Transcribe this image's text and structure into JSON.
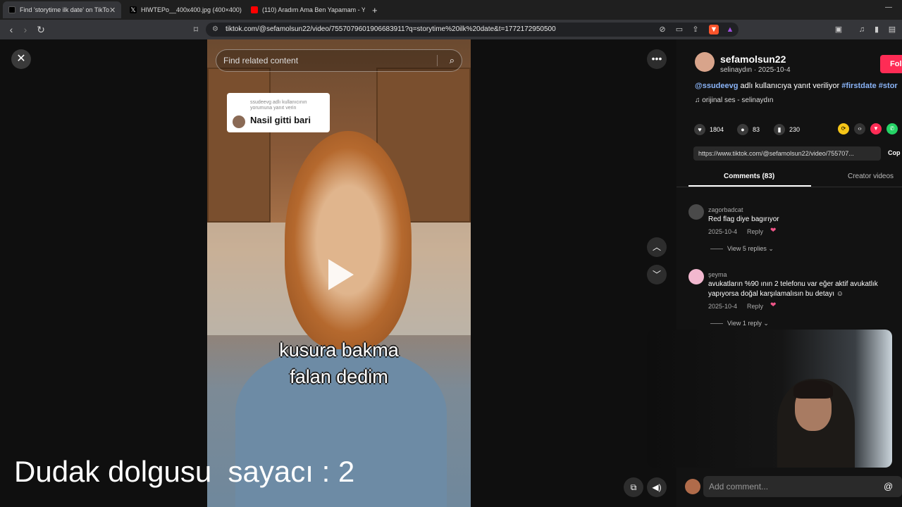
{
  "tabs": [
    {
      "title": "Find 'storytime ilk date' on TikTo",
      "close": "✕"
    },
    {
      "title": "HIWTEPo__400x400.jpg (400×400)"
    },
    {
      "title": "(110) Aradım Ama Ben Yapamam - Yo"
    }
  ],
  "new_tab": "+",
  "minimize": "—",
  "url": "tiktok.com/@sefamolsun22/video/7557079601906683911?q=storytime%20ilk%20date&t=1772172950500",
  "search": {
    "placeholder": "Find related content"
  },
  "reply_card": {
    "small": "ssudeevg adlı kullanıcının yorumuna yanıt verin",
    "big": "Nasil gitti bari"
  },
  "caption": {
    "line1": "kusura bakma",
    "line2": "falan dedim"
  },
  "overlay_counter": "Dudak dolgusu  sayacı : 2",
  "author": {
    "name": "sefamolsun22",
    "meta": "selinaydın · 2025-10-4",
    "follow": "Fol"
  },
  "description": {
    "mention": "@ssudeevg",
    "text": " adlı kullanıcıya yanıt veriliyor ",
    "tags": "#firstdate #stor"
  },
  "music": "♫  orijinal ses - selinaydın",
  "stats": {
    "likes": "1804",
    "comments": "83",
    "saves": "230"
  },
  "share_link": "https://www.tiktok.com/@sefamolsun22/video/755707...",
  "copy": "Cop",
  "comment_tabs": {
    "comments": "Comments (83)",
    "creator": "Creator videos"
  },
  "comments": [
    {
      "user": "zagorbadcat",
      "text": "Red flag diye bagırıyor",
      "date": "2025-10-4",
      "reply": "Reply",
      "replies": "View 5 replies ⌄"
    },
    {
      "user": "şeyma",
      "text": "avukatların %90 ının 2 telefonu var eğer aktif avukatlık yapıyorsa doğal karşılamalısın bu detayı ☺",
      "date": "2025-10-4",
      "reply": "Reply",
      "replies": "View 1 reply ⌄"
    }
  ],
  "add_comment": {
    "placeholder": "Add comment...",
    "at": "@"
  },
  "colors": {
    "accent": "#fe2c55",
    "tag": "#8ab4f8",
    "background": "#121212"
  }
}
